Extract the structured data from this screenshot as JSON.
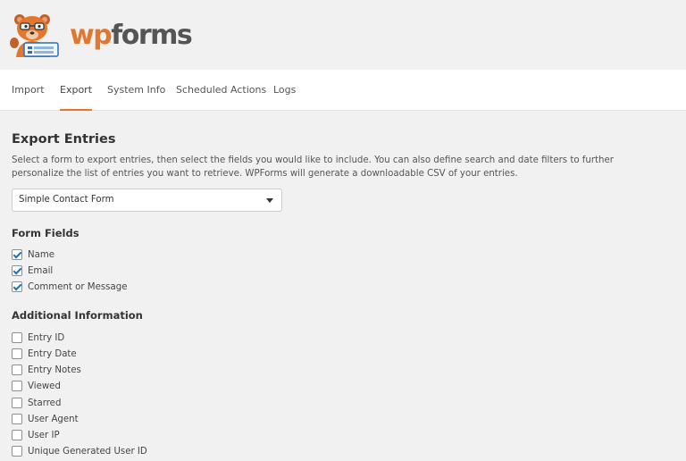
{
  "logo": {
    "wp": "wp",
    "forms": "forms"
  },
  "tabs": [
    {
      "label": "Import",
      "active": false
    },
    {
      "label": "Export",
      "active": true
    },
    {
      "label": "System Info",
      "active": false
    },
    {
      "label": "Scheduled Actions",
      "active": false
    },
    {
      "label": "Logs",
      "active": false
    }
  ],
  "export": {
    "title": "Export Entries",
    "description": "Select a form to export entries, then select the fields you would like to include. You can also define search and date filters to further personalize the list of entries you want to retrieve. WPForms will generate a downloadable CSV of your entries.",
    "form_select": {
      "value": "Simple Contact Form",
      "icon": "chevron-down-icon"
    },
    "form_fields": {
      "title": "Form Fields",
      "items": [
        {
          "label": "Name",
          "checked": true
        },
        {
          "label": "Email",
          "checked": true
        },
        {
          "label": "Comment or Message",
          "checked": true
        }
      ]
    },
    "additional": {
      "title": "Additional Information",
      "items": [
        {
          "label": "Entry ID",
          "checked": false
        },
        {
          "label": "Entry Date",
          "checked": false
        },
        {
          "label": "Entry Notes",
          "checked": false
        },
        {
          "label": "Viewed",
          "checked": false
        },
        {
          "label": "Starred",
          "checked": false
        },
        {
          "label": "User Agent",
          "checked": false
        },
        {
          "label": "User IP",
          "checked": false
        },
        {
          "label": "Unique Generated User ID",
          "checked": false
        }
      ]
    }
  },
  "colors": {
    "accent": "#e27730",
    "check": "#2271b1",
    "background": "#f1f1f1"
  }
}
